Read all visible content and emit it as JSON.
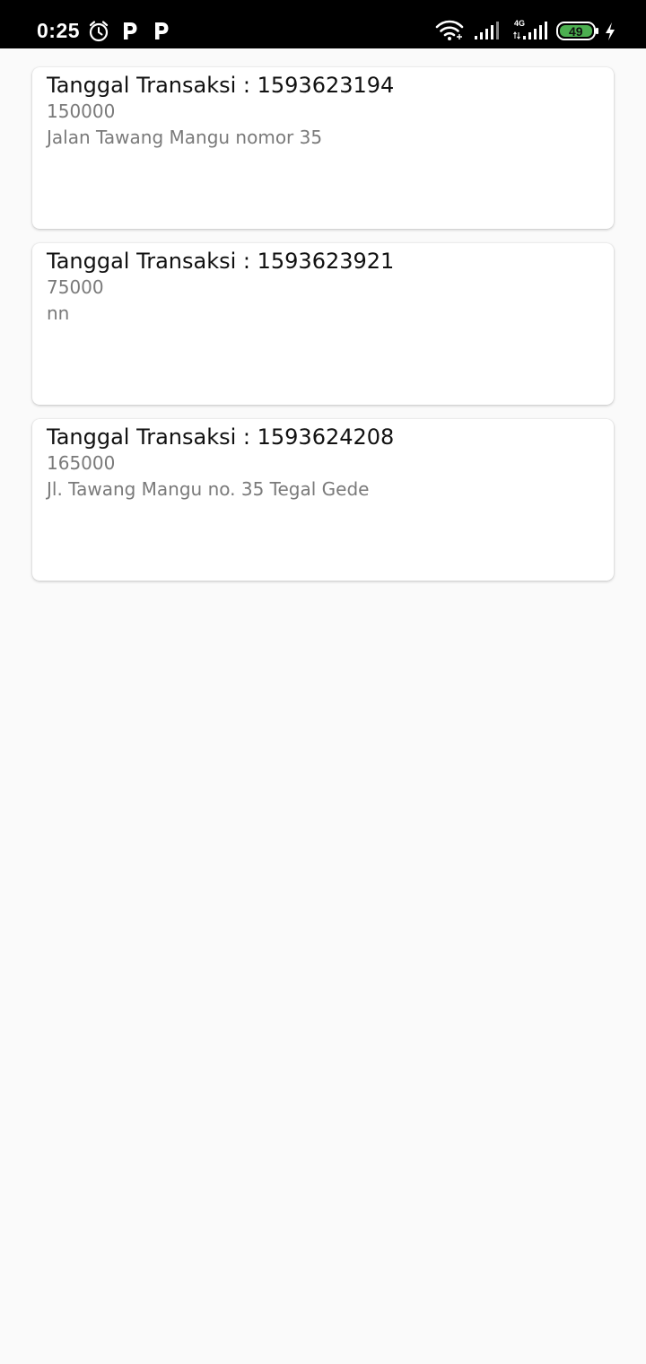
{
  "status_bar": {
    "time": "0:25",
    "battery_level": "49",
    "network_type": "4G",
    "icons": [
      "alarm-icon",
      "parking-icon",
      "parking-icon",
      "wifi-icon",
      "signal-icon",
      "signal-4g-icon",
      "battery-icon",
      "charging-icon"
    ],
    "battery_color": "#4caf50"
  },
  "transactions": [
    {
      "title": "Tanggal Transaksi : 1593623194",
      "amount": "150000",
      "address": "Jalan Tawang Mangu nomor 35"
    },
    {
      "title": "Tanggal Transaksi : 1593623921",
      "amount": "75000",
      "address": "nn"
    },
    {
      "title": "Tanggal Transaksi : 1593624208",
      "amount": "165000",
      "address": "Jl. Tawang Mangu no. 35 Tegal Gede"
    }
  ]
}
